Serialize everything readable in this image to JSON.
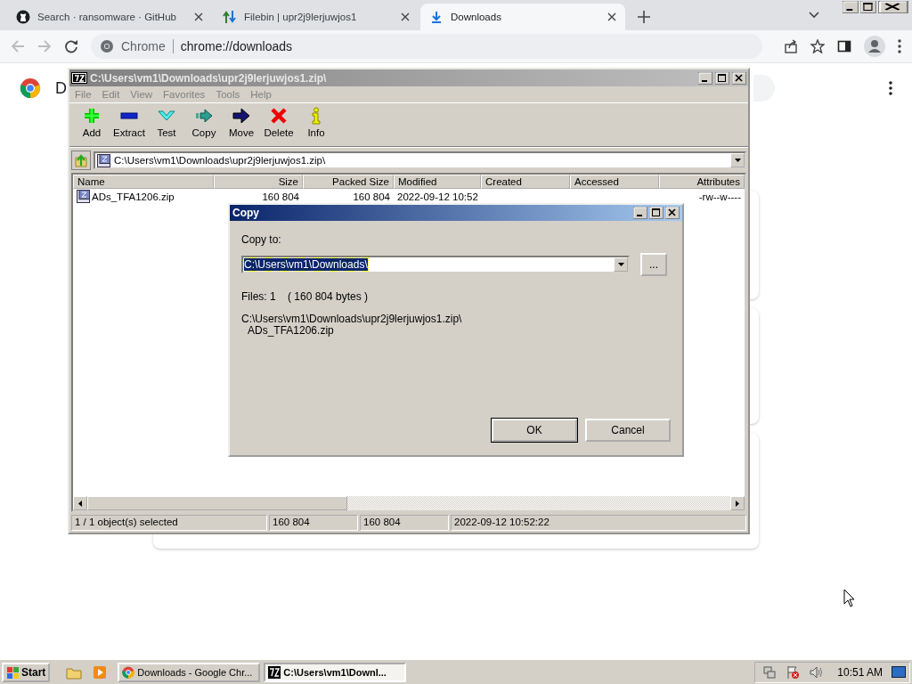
{
  "browser": {
    "tabs": [
      {
        "title": "Search · ransomware · GitHub",
        "selected": false
      },
      {
        "title": "Filebin | upr2j9lerjuwjos1",
        "selected": false
      },
      {
        "title": "Downloads",
        "selected": true
      }
    ],
    "omnibox": {
      "site": "Chrome",
      "url": "chrome://downloads"
    }
  },
  "page": {
    "heading": "D"
  },
  "zip_window": {
    "title": "C:\\Users\\vm1\\Downloads\\upr2j9lerjuwjos1.zip\\",
    "menu": [
      "File",
      "Edit",
      "View",
      "Favorites",
      "Tools",
      "Help"
    ],
    "toolbar": [
      {
        "label": "Add",
        "kind": "add"
      },
      {
        "label": "Extract",
        "kind": "extract"
      },
      {
        "label": "Test",
        "kind": "test"
      },
      {
        "label": "Copy",
        "kind": "copy"
      },
      {
        "label": "Move",
        "kind": "move"
      },
      {
        "label": "Delete",
        "kind": "delete"
      },
      {
        "label": "Info",
        "kind": "info"
      }
    ],
    "path": "C:\\Users\\vm1\\Downloads\\upr2j9lerjuwjos1.zip\\",
    "columns": [
      "Name",
      "Size",
      "Packed Size",
      "Modified",
      "Created",
      "Accessed",
      "Attributes"
    ],
    "rows": [
      {
        "name": "ADs_TFA1206.zip",
        "size": "160 804",
        "packed_size": "160 804",
        "modified": "2022-09-12 10:52",
        "attributes": "-rw--w----"
      }
    ],
    "status_bar": [
      "1 / 1 object(s) selected",
      "160 804",
      "160 804",
      "2022-09-12 10:52:22"
    ]
  },
  "copy_dialog": {
    "title": "Copy",
    "label": "Copy to:",
    "destination": "C:\\Users\\vm1\\Downloads\\",
    "destination_selected": true,
    "browse": "...",
    "files": "Files: 1    ( 160 804 bytes )",
    "source": [
      "C:\\Users\\vm1\\Downloads\\upr2j9lerjuwjos1.zip\\",
      "ADs_TFA1206.zip"
    ],
    "buttons": [
      "OK",
      "Cancel"
    ]
  },
  "taskbar": {
    "start": "Start",
    "tasks": [
      {
        "title": "Downloads - Google Chr...",
        "selected": false
      },
      {
        "title": "C:\\Users\\vm1\\Downl...",
        "selected": true
      }
    ],
    "clock": "10:51 AM"
  }
}
